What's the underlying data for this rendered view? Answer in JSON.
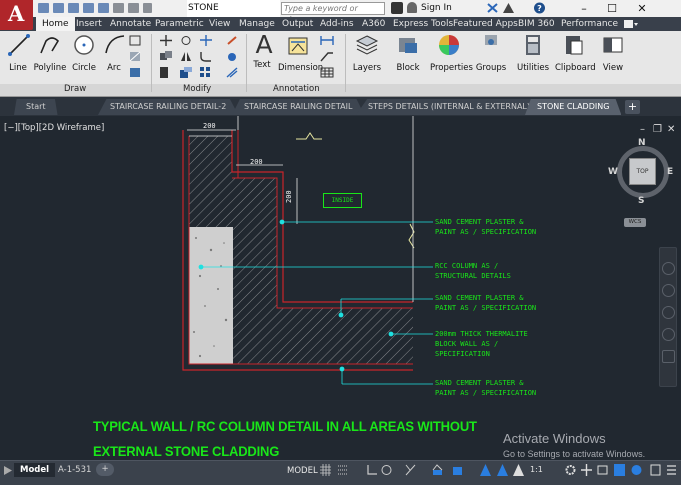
{
  "app": {
    "filename": "STONE CLADDING.dwg",
    "search_placeholder": "Type a keyword or phrase",
    "sign_in": "Sign In",
    "help": "?"
  },
  "ribbon_tabs": [
    {
      "label": "Home",
      "active": true
    },
    {
      "label": "Insert"
    },
    {
      "label": "Annotate"
    },
    {
      "label": "Parametric"
    },
    {
      "label": "View"
    },
    {
      "label": "Manage"
    },
    {
      "label": "Output"
    },
    {
      "label": "Add-ins"
    },
    {
      "label": "A360"
    },
    {
      "label": "Express Tools"
    },
    {
      "label": "Featured Apps"
    },
    {
      "label": "BIM 360"
    },
    {
      "label": "Performance"
    }
  ],
  "ribbon": {
    "line": "Line",
    "polyline": "Polyline",
    "circle": "Circle",
    "arc": "Arc",
    "draw_panel": "Draw",
    "modify_panel": "Modify",
    "text": "Text",
    "dimension": "Dimension",
    "annotation_panel": "Annotation",
    "layers": "Layers",
    "block": "Block",
    "properties": "Properties",
    "groups": "Groups",
    "utilities": "Utilities",
    "clipboard": "Clipboard",
    "view": "View"
  },
  "doc_tabs": [
    {
      "label": "Start"
    },
    {
      "label": "STAIRCASE RAILING DETAIL-2"
    },
    {
      "label": "STAIRCASE RAILING DETAIL"
    },
    {
      "label": "STEPS DETAILS (INTERNAL & EXTERNAL)"
    },
    {
      "label": "STONE CLADDING",
      "active": true
    }
  ],
  "viewport": {
    "label": "[−][Top][2D Wireframe]",
    "viewcube": {
      "n": "N",
      "s": "S",
      "e": "E",
      "w": "W",
      "top": "TOP",
      "wcs": "WCS"
    }
  },
  "drawing": {
    "dims": [
      "200",
      "200",
      "200"
    ],
    "inside_label": "INSIDE",
    "notes": [
      [
        "SAND CEMENT PLASTER &",
        "PAINT AS / SPECIFICATION"
      ],
      [
        "RCC COLUMN AS /",
        "STRUCTURAL DETAILS"
      ],
      [
        "SAND CEMENT PLASTER &",
        "PAINT AS / SPECIFICATION"
      ],
      [
        "200mm THICK THERMALITE",
        "BLOCK WALL AS /",
        "SPECIFICATION"
      ],
      [
        "SAND CEMENT PLASTER &",
        "PAINT AS / SPECIFICATION"
      ]
    ],
    "title_line1": "TYPICAL WALL / RC COLUMN DETAIL IN ALL AREAS WITHOUT",
    "title_line2": "EXTERNAL STONE CLADDING"
  },
  "watermark": {
    "line1": "Activate Windows",
    "line2": "Go to Settings to activate Windows."
  },
  "status": {
    "layout_tabs": [
      {
        "label": "Model",
        "active": true
      },
      {
        "label": "A-1-531"
      }
    ],
    "add_tab": "+",
    "model_space": "MODEL",
    "scale": "1:1"
  },
  "colors": {
    "annotation_green": "#19e619",
    "leader_cyan": "#20e0e0",
    "wall_red": "#c8242a",
    "canvas_bg": "#212830"
  }
}
